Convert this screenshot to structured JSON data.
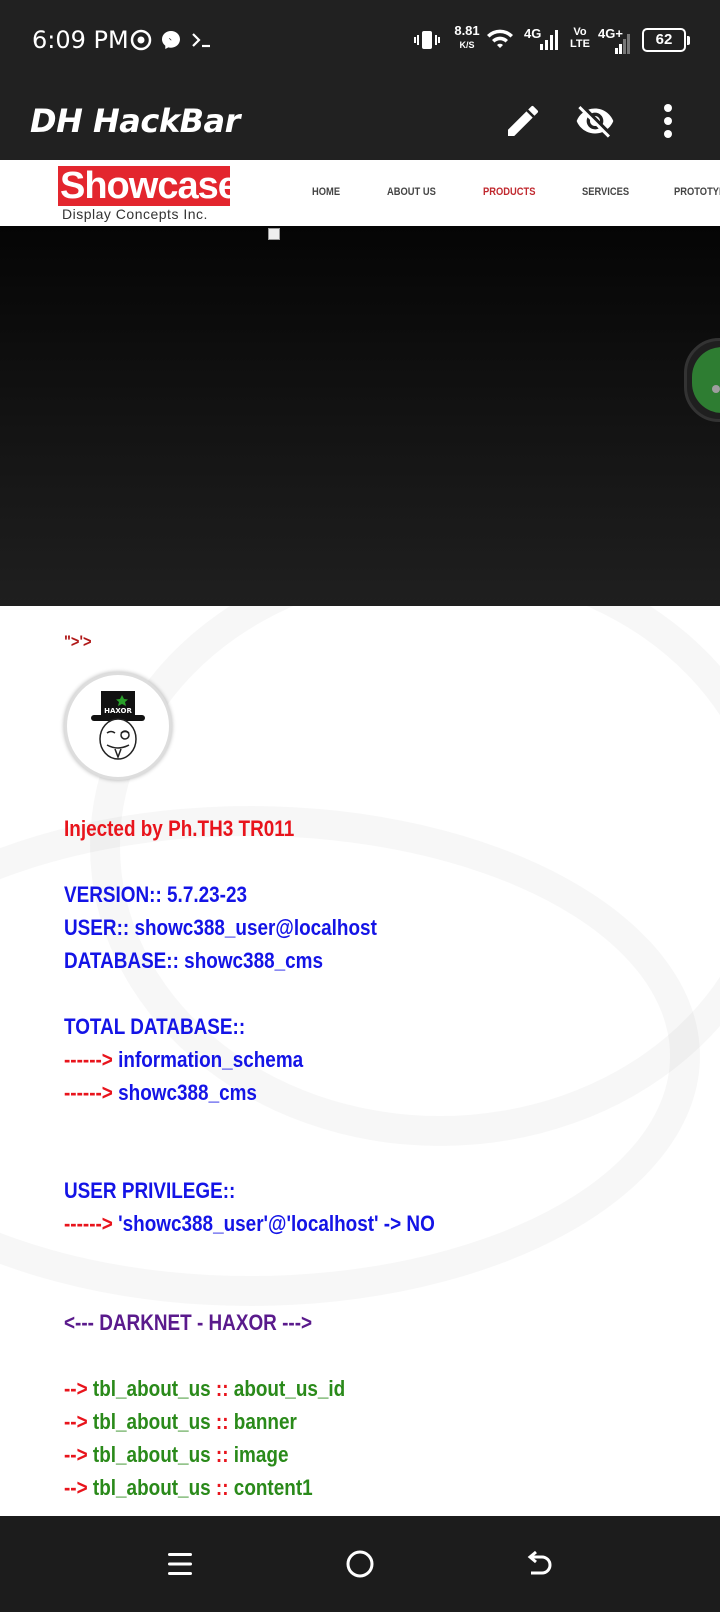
{
  "status": {
    "time": "6:09 PM",
    "net_speed": "8.81",
    "net_speed_unit": "K/S",
    "sig1_label": "4G",
    "volte_top": "Vo",
    "volte_bottom": "LTE",
    "sig2_label": "4G+",
    "battery": "62",
    "icons": [
      "chrome-icon",
      "messenger-icon",
      "terminal-icon",
      "vibrate-icon",
      "wifi-icon",
      "signal-icon",
      "battery-icon"
    ]
  },
  "app_bar": {
    "title": "DH HackBar",
    "actions": [
      "edit-icon",
      "visibility-off-icon",
      "more-vert-icon"
    ]
  },
  "site": {
    "logo_text": "Showcase",
    "logo_subtitle": "Display Concepts Inc.",
    "nav": [
      "HOME",
      "ABOUT US",
      "PRODUCTS",
      "SERVICES",
      "PROTOTYP"
    ],
    "active_nav": "PRODUCTS",
    "accent_color": "#e3262e"
  },
  "injection": {
    "stray_text": "\">'>",
    "avatar_caption": "HAXOR",
    "banner": "Injected by Ph.TH3 TR011",
    "version_label": "VERSION::",
    "version": "5.7.23-23",
    "user_label": "USER::",
    "user": "showc388_user@localhost",
    "database_label": "DATABASE::",
    "database": "showc388_cms",
    "total_db_label": "TOTAL DATABASE::",
    "arrow": "------>",
    "databases": [
      "information_schema",
      "showc388_cms"
    ],
    "privilege_label": "USER PRIVILEGE::",
    "privilege": "'showc388_user'@'localhost' -> NO",
    "section_header": "<--- DARKNET - HAXOR --->",
    "col_arrow": "-->",
    "col_sep": "::",
    "columns": [
      {
        "table": "tbl_about_us",
        "column": "about_us_id"
      },
      {
        "table": "tbl_about_us",
        "column": "banner"
      },
      {
        "table": "tbl_about_us",
        "column": "image"
      },
      {
        "table": "tbl_about_us",
        "column": "content1"
      }
    ]
  },
  "nav_bar": [
    "menu-icon",
    "home-circle-icon",
    "back-icon"
  ]
}
